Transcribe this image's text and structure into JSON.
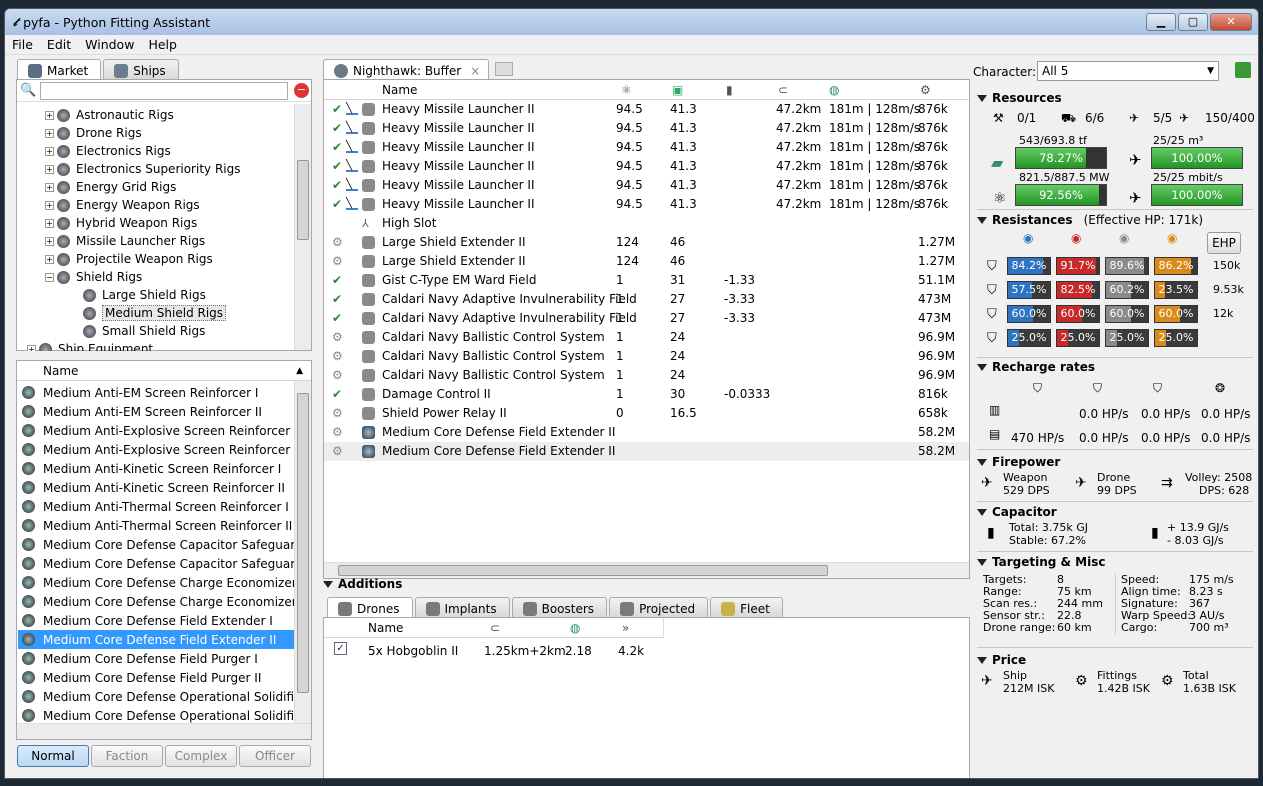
{
  "window": {
    "title": "pyfa - Python Fitting Assistant",
    "min": "▁",
    "max": "▢",
    "close": "✕"
  },
  "menu": [
    "File",
    "Edit",
    "Window",
    "Help"
  ],
  "left_tabs": [
    {
      "label": "Market",
      "icon": "market-icon"
    },
    {
      "label": "Ships",
      "icon": "ships-icon"
    }
  ],
  "search": {
    "value": "",
    "placeholder": ""
  },
  "tree": [
    {
      "label": "Astronautic Rigs",
      "exp": "+",
      "indent": 1
    },
    {
      "label": "Drone Rigs",
      "exp": "+",
      "indent": 1
    },
    {
      "label": "Electronics Rigs",
      "exp": "+",
      "indent": 1
    },
    {
      "label": "Electronics Superiority Rigs",
      "exp": "+",
      "indent": 1
    },
    {
      "label": "Energy Grid Rigs",
      "exp": "+",
      "indent": 1
    },
    {
      "label": "Energy Weapon Rigs",
      "exp": "+",
      "indent": 1
    },
    {
      "label": "Hybrid Weapon Rigs",
      "exp": "+",
      "indent": 1
    },
    {
      "label": "Missile Launcher Rigs",
      "exp": "+",
      "indent": 1
    },
    {
      "label": "Projectile Weapon Rigs",
      "exp": "+",
      "indent": 1
    },
    {
      "label": "Shield Rigs",
      "exp": "−",
      "indent": 1
    },
    {
      "label": "Large Shield Rigs",
      "exp": "",
      "indent": 2
    },
    {
      "label": "Medium Shield Rigs",
      "exp": "",
      "indent": 2,
      "selected": true
    },
    {
      "label": "Small Shield Rigs",
      "exp": "",
      "indent": 2
    },
    {
      "label": "Ship Equipment",
      "exp": "+",
      "indent": 0
    }
  ],
  "item_list_header": "Name",
  "items": [
    "Medium Anti-EM Screen Reinforcer I",
    "Medium Anti-EM Screen Reinforcer II",
    "Medium Anti-Explosive Screen Reinforcer I",
    "Medium Anti-Explosive Screen Reinforcer II",
    "Medium Anti-Kinetic Screen Reinforcer I",
    "Medium Anti-Kinetic Screen Reinforcer II",
    "Medium Anti-Thermal Screen Reinforcer I",
    "Medium Anti-Thermal Screen Reinforcer II",
    "Medium Core Defense Capacitor Safeguard I",
    "Medium Core Defense Capacitor Safeguard II",
    "Medium Core Defense Charge Economizer I",
    "Medium Core Defense Charge Economizer II",
    "Medium Core Defense Field Extender I",
    "Medium Core Defense Field Extender II",
    "Medium Core Defense Field Purger I",
    "Medium Core Defense Field Purger II",
    "Medium Core Defense Operational Solidifier I",
    "Medium Core Defense Operational Solidifier II"
  ],
  "items_selected_index": 13,
  "meta_buttons": [
    {
      "label": "Normal",
      "sel": true
    },
    {
      "label": "Faction"
    },
    {
      "label": "Complex"
    },
    {
      "label": "Officer"
    }
  ],
  "fit_tab": {
    "label": "Nighthawk: Buffer",
    "close": "×"
  },
  "fit_columns": {
    "name": "Name"
  },
  "fit_rows": [
    {
      "state": "✔",
      "name": "Heavy Missile Launcher II",
      "c1": "94.5",
      "c2": "41.3",
      "c3": "",
      "c4": "47.2km",
      "c5": "181m | 128m/s",
      "c6": "876k",
      "c7": "",
      "t": "hi"
    },
    {
      "state": "✔",
      "name": "Heavy Missile Launcher II",
      "c1": "94.5",
      "c2": "41.3",
      "c3": "",
      "c4": "47.2km",
      "c5": "181m | 128m/s",
      "c6": "876k",
      "c7": "",
      "t": "hi"
    },
    {
      "state": "✔",
      "name": "Heavy Missile Launcher II",
      "c1": "94.5",
      "c2": "41.3",
      "c3": "",
      "c4": "47.2km",
      "c5": "181m | 128m/s",
      "c6": "876k",
      "c7": "",
      "t": "hi"
    },
    {
      "state": "✔",
      "name": "Heavy Missile Launcher II",
      "c1": "94.5",
      "c2": "41.3",
      "c3": "",
      "c4": "47.2km",
      "c5": "181m | 128m/s",
      "c6": "876k",
      "c7": "",
      "t": "hi"
    },
    {
      "state": "✔",
      "name": "Heavy Missile Launcher II",
      "c1": "94.5",
      "c2": "41.3",
      "c3": "",
      "c4": "47.2km",
      "c5": "181m | 128m/s",
      "c6": "876k",
      "c7": "",
      "t": "hi"
    },
    {
      "state": "✔",
      "name": "Heavy Missile Launcher II",
      "c1": "94.5",
      "c2": "41.3",
      "c3": "",
      "c4": "47.2km",
      "c5": "181m | 128m/s",
      "c6": "876k",
      "c7": "",
      "t": "hi"
    },
    {
      "state": "",
      "name": "High Slot",
      "c1": "",
      "c2": "",
      "c3": "",
      "c4": "",
      "c5": "",
      "c6": "",
      "c7": "",
      "t": "empty"
    },
    {
      "state": "⚙",
      "name": "Large Shield Extender II",
      "c1": "124",
      "c2": "46",
      "c3": "",
      "c4": "",
      "c5": "",
      "c6": "",
      "c7": "1.27M",
      "t": "mid"
    },
    {
      "state": "⚙",
      "name": "Large Shield Extender II",
      "c1": "124",
      "c2": "46",
      "c3": "",
      "c4": "",
      "c5": "",
      "c6": "",
      "c7": "1.27M",
      "t": "mid"
    },
    {
      "state": "✔",
      "name": "Gist C-Type EM Ward Field",
      "c1": "1",
      "c2": "31",
      "c3": "-1.33",
      "c4": "",
      "c5": "",
      "c6": "",
      "c7": "51.1M",
      "t": "mid"
    },
    {
      "state": "✔",
      "name": "Caldari Navy Adaptive Invulnerability Field",
      "c1": "1",
      "c2": "27",
      "c3": "-3.33",
      "c4": "",
      "c5": "",
      "c6": "",
      "c7": "473M",
      "t": "mid"
    },
    {
      "state": "✔",
      "name": "Caldari Navy Adaptive Invulnerability Field",
      "c1": "1",
      "c2": "27",
      "c3": "-3.33",
      "c4": "",
      "c5": "",
      "c6": "",
      "c7": "473M",
      "t": "mid"
    },
    {
      "state": "⚙",
      "name": "Caldari Navy Ballistic Control System",
      "c1": "1",
      "c2": "24",
      "c3": "",
      "c4": "",
      "c5": "",
      "c6": "",
      "c7": "96.9M",
      "t": "low"
    },
    {
      "state": "⚙",
      "name": "Caldari Navy Ballistic Control System",
      "c1": "1",
      "c2": "24",
      "c3": "",
      "c4": "",
      "c5": "",
      "c6": "",
      "c7": "96.9M",
      "t": "low"
    },
    {
      "state": "⚙",
      "name": "Caldari Navy Ballistic Control System",
      "c1": "1",
      "c2": "24",
      "c3": "",
      "c4": "",
      "c5": "",
      "c6": "",
      "c7": "96.9M",
      "t": "low"
    },
    {
      "state": "✔",
      "name": "Damage Control II",
      "c1": "1",
      "c2": "30",
      "c3": "-0.0333",
      "c4": "",
      "c5": "",
      "c6": "",
      "c7": "816k",
      "t": "low"
    },
    {
      "state": "⚙",
      "name": "Shield Power Relay II",
      "c1": "0",
      "c2": "16.5",
      "c3": "",
      "c4": "",
      "c5": "",
      "c6": "",
      "c7": "658k",
      "t": "low"
    },
    {
      "state": "⚙",
      "name": "Medium Core Defense Field Extender II",
      "c1": "",
      "c2": "",
      "c3": "",
      "c4": "",
      "c5": "",
      "c6": "",
      "c7": "58.2M",
      "t": "rig"
    },
    {
      "state": "⚙",
      "name": "Medium Core Defense Field Extender II",
      "c1": "",
      "c2": "",
      "c3": "",
      "c4": "",
      "c5": "",
      "c6": "",
      "c7": "58.2M",
      "t": "rig",
      "sel": true
    }
  ],
  "additions": {
    "title": "Additions",
    "tabs": [
      "Drones",
      "Implants",
      "Boosters",
      "Projected",
      "Fleet"
    ],
    "columns": {
      "name": "Name"
    },
    "drones": [
      {
        "checked": true,
        "name": "5x Hobgoblin II",
        "range": "1.25km+2km",
        "speed": "2.18",
        "price": "4.2k"
      }
    ]
  },
  "character": {
    "label": "Character:",
    "value": "All 5"
  },
  "resources": {
    "title": "Resources",
    "slots": [
      {
        "icon": "turret-icon",
        "val": "0/1"
      },
      {
        "icon": "launcher-icon",
        "val": "6/6"
      },
      {
        "icon": "drone-icon",
        "val": "5/5"
      },
      {
        "icon": "drone-bay-icon",
        "val": "150/400"
      }
    ],
    "cpu": {
      "label": "543/693.8 tf",
      "pct": "78.27%",
      "fill": 78.27
    },
    "drone_bay": {
      "label": "25/25 m³",
      "pct": "100.00%",
      "fill": 100
    },
    "pg": {
      "label": "821.5/887.5 MW",
      "pct": "92.56%",
      "fill": 92.56
    },
    "bandwidth": {
      "label": "25/25 mbit/s",
      "pct": "100.00%",
      "fill": 100
    }
  },
  "resistances": {
    "title": "Resistances",
    "ehp_label": "(Effective HP: 171k)",
    "ehp_btn": "EHP",
    "rows": [
      {
        "layer": "shield",
        "vals": [
          "84.2%",
          "91.7%",
          "89.6%",
          "86.2%"
        ],
        "fills": [
          84.2,
          91.7,
          89.6,
          86.2
        ],
        "ehp": "150k"
      },
      {
        "layer": "armor",
        "vals": [
          "57.5%",
          "82.5%",
          "60.2%",
          "23.5%"
        ],
        "fills": [
          57.5,
          82.5,
          60.2,
          23.5
        ],
        "ehp": "9.53k"
      },
      {
        "layer": "hull",
        "vals": [
          "60.0%",
          "60.0%",
          "60.0%",
          "60.0%"
        ],
        "fills": [
          60,
          60,
          60,
          60
        ],
        "ehp": "12k"
      },
      {
        "layer": "damage-pattern",
        "vals": [
          "25.0%",
          "25.0%",
          "25.0%",
          "25.0%"
        ],
        "fills": [
          25,
          25,
          25,
          25
        ],
        "ehp": ""
      }
    ],
    "colors": [
      "#2f74c0",
      "#c62a2a",
      "#8a8a8a",
      "#d98a1a"
    ]
  },
  "recharge": {
    "title": "Recharge rates",
    "row1": [
      "",
      "0.0 HP/s",
      "0.0 HP/s",
      "0.0 HP/s"
    ],
    "row2": [
      "470 HP/s",
      "0.0 HP/s",
      "0.0 HP/s",
      "0.0 HP/s"
    ]
  },
  "firepower": {
    "title": "Firepower",
    "weapon": "Weapon",
    "weapon_dps": "529 DPS",
    "drone": "Drone",
    "drone_dps": "99 DPS",
    "volley": "Volley: 2508",
    "dps": "DPS: 628"
  },
  "capacitor": {
    "title": "Capacitor",
    "total": "Total: 3.75k GJ",
    "stable": "Stable: 67.2%",
    "plus": "+ 13.9 GJ/s",
    "minus": "- 8.03 GJ/s"
  },
  "targeting": {
    "title": "Targeting & Misc",
    "left": [
      [
        "Targets:",
        "8"
      ],
      [
        "Range:",
        "75 km"
      ],
      [
        "Scan res.:",
        "244 mm"
      ],
      [
        "Sensor str.:",
        "22.8"
      ],
      [
        "Drone range:",
        "60 km"
      ]
    ],
    "right": [
      [
        "Speed:",
        "175 m/s"
      ],
      [
        "Align time:",
        "8.23 s"
      ],
      [
        "Signature:",
        "367"
      ],
      [
        "Warp Speed:",
        "3 AU/s"
      ],
      [
        "Cargo:",
        "700 m³"
      ]
    ]
  },
  "price": {
    "title": "Price",
    "ship": "Ship",
    "ship_val": "212M ISK",
    "fittings": "Fittings",
    "fittings_val": "1.42B ISK",
    "total": "Total",
    "total_val": "1.63B ISK"
  }
}
